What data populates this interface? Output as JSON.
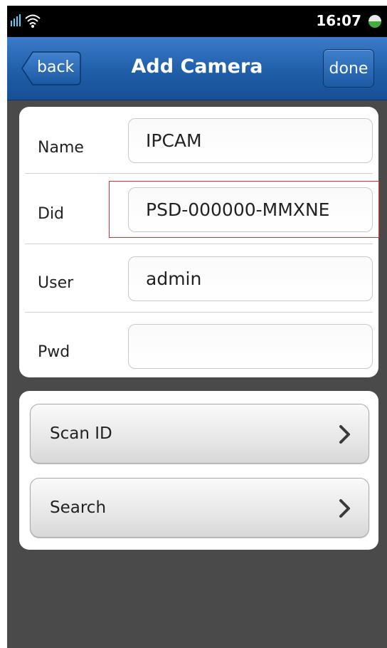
{
  "status_bar": {
    "time": "16:07",
    "icons": [
      "signal-icon",
      "wifi-icon",
      "battery-icon"
    ]
  },
  "nav": {
    "back_label": "back",
    "title": "Add Camera",
    "done_label": "done"
  },
  "form": {
    "fields": [
      {
        "label": "Name",
        "value": "IPCAM"
      },
      {
        "label": "Did",
        "value": "PSD-000000-MMXNE"
      },
      {
        "label": "User",
        "value": "admin"
      },
      {
        "label": "Pwd",
        "value": ""
      }
    ]
  },
  "actions": [
    {
      "label": "Scan ID",
      "icon": "chevron-right-icon"
    },
    {
      "label": "Search",
      "icon": "chevron-right-icon"
    }
  ],
  "colors": {
    "nav_blue": "#1f5ea9",
    "background": "#4a4a4a",
    "highlight": "#e03030"
  }
}
